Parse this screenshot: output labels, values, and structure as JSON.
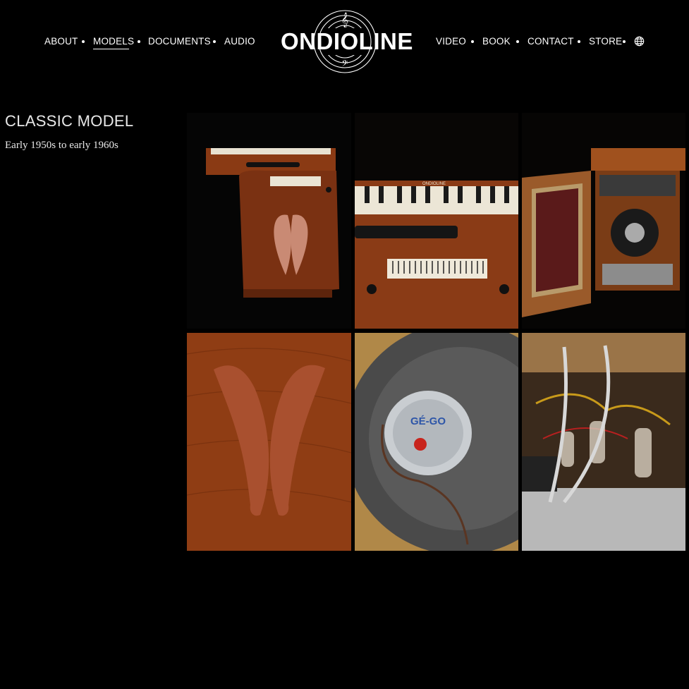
{
  "nav": {
    "about": "ABOUT",
    "models": "MODELS",
    "documents": "DOCUMENTS",
    "audio": "AUDIO",
    "video": "VIDEO",
    "book": "BOOK",
    "contact": "CONTACT",
    "store": "STORE",
    "active": "MODELS",
    "language_icon": "globe-icon"
  },
  "logo": {
    "text": "ONDIOLINE"
  },
  "page": {
    "title": "CLASSIC MODEL",
    "subtitle": "Early 1950s to early 1960s"
  },
  "photos": {
    "front_keyboard_label": "ONDIOLINE",
    "speaker_badge": "GÉ-GO"
  },
  "colors": {
    "background": "#000000",
    "text": "#ffffff",
    "wood": "#8a3a12"
  }
}
